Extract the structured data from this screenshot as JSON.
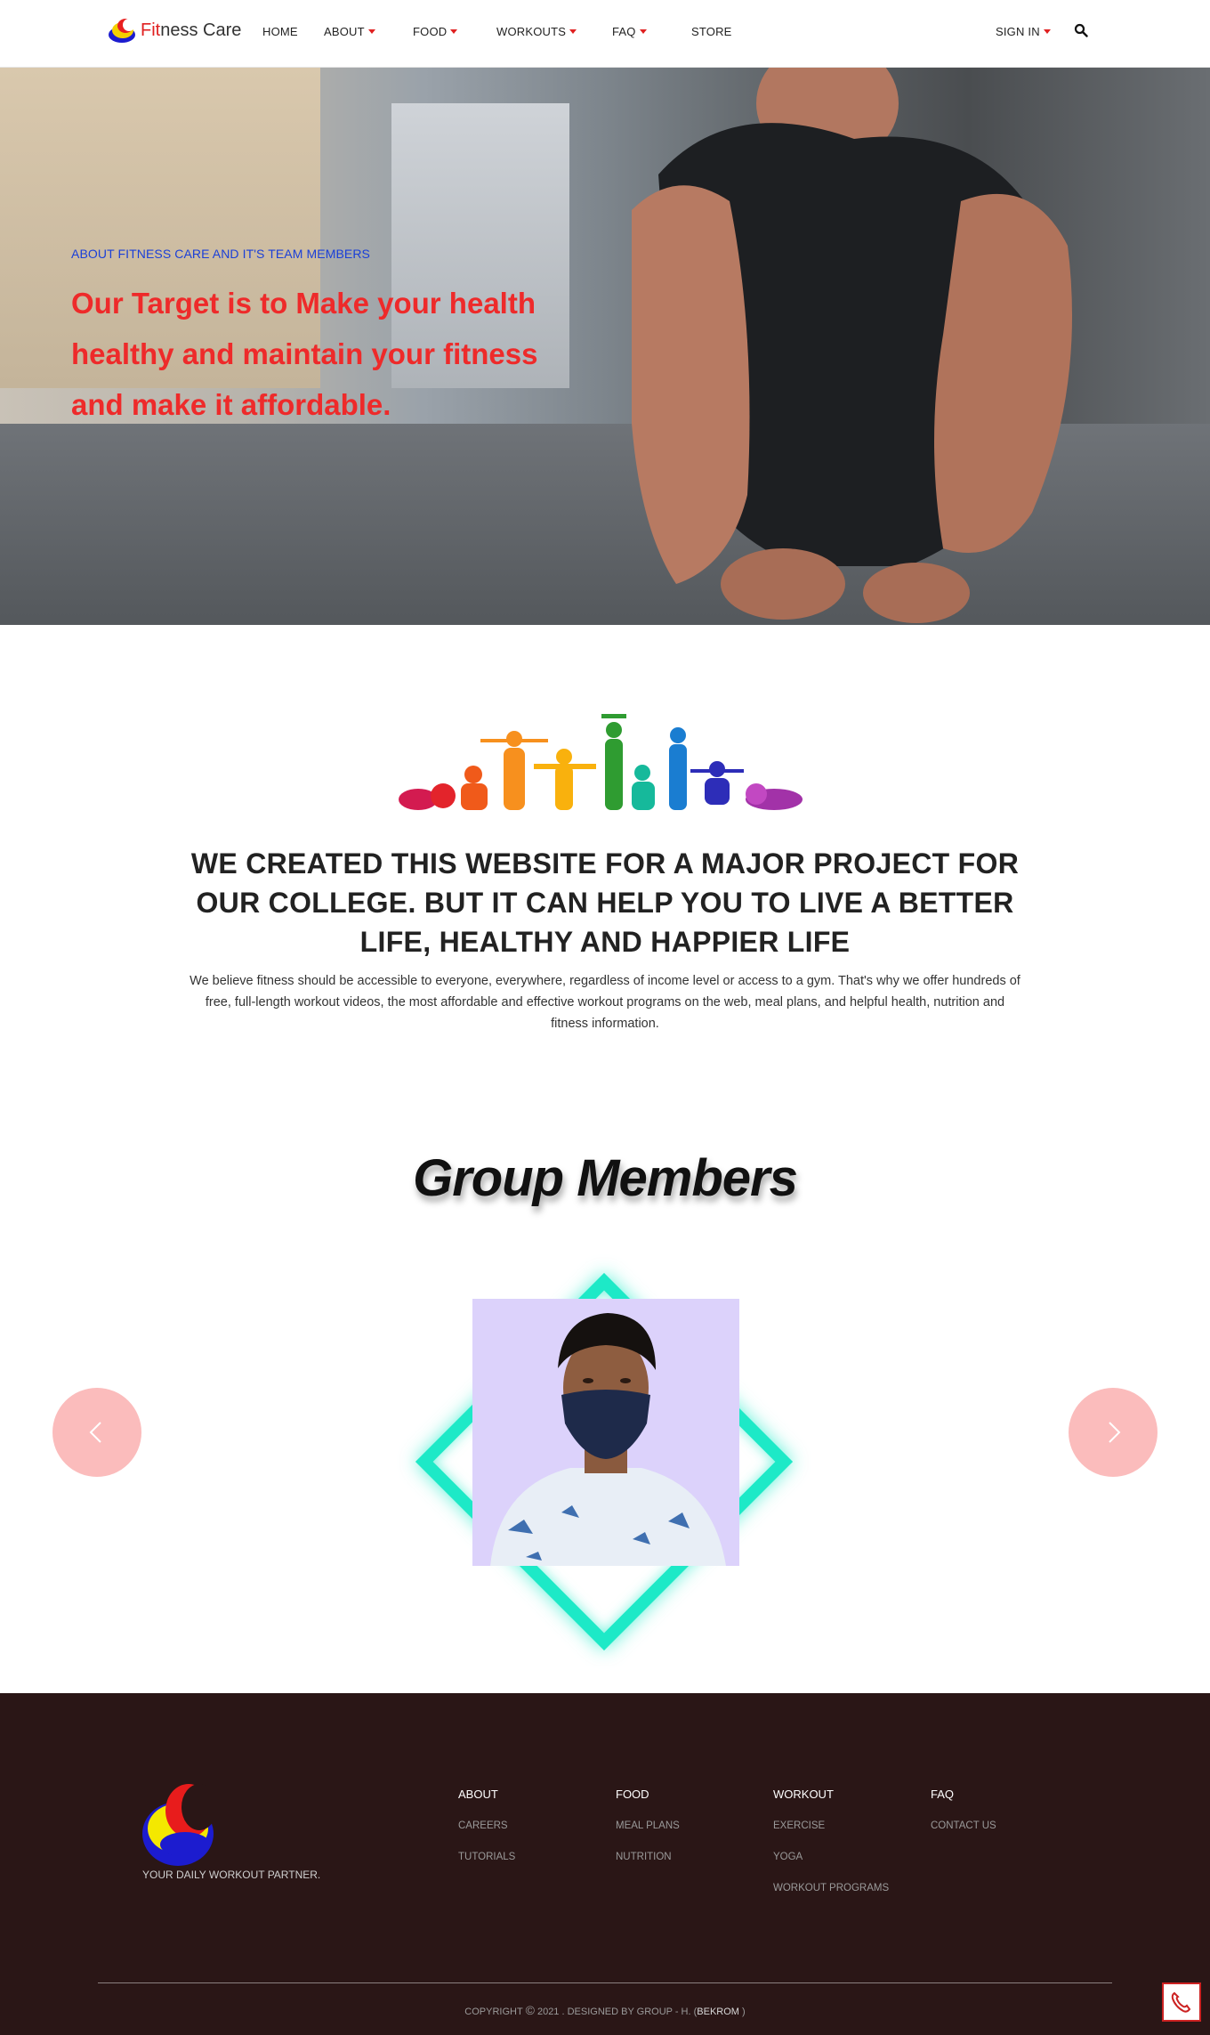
{
  "brand": {
    "name_part1": "Fit",
    "name_part2": "ness Care"
  },
  "nav": {
    "home": "HOME",
    "about": "ABOUT",
    "food": "FOOD",
    "workouts": "WORKOUTS",
    "faq": "FAQ",
    "store": "STORE",
    "sign_in": "SIGN IN"
  },
  "hero": {
    "subtitle": "ABOUT FITNESS CARE AND IT'S TEAM MEMBERS",
    "title": "Our Target is to Make your health healthy and maintain your fitness and make it affordable."
  },
  "about": {
    "headline": "WE CREATED THIS WEBSITE FOR A MAJOR PROJECT FOR OUR COLLEGE. BUT IT CAN HELP YOU TO LIVE A BETTER LIFE, HEALTHY AND HAPPIER LIFE",
    "body": "We believe fitness should be accessible to everyone, everywhere, regardless of income level or access to a gym. That's why we offer hundreds of free, full-length workout videos, the most affordable and effective workout programs on the web, meal plans, and helpful health, nutrition and fitness information."
  },
  "group": {
    "title": "Group Members"
  },
  "footer": {
    "tagline": "YOUR DAILY WORKOUT PARTNER.",
    "columns": [
      {
        "title": "ABOUT",
        "links": [
          "CAREERS",
          "TUTORIALS"
        ]
      },
      {
        "title": "FOOD",
        "links": [
          "MEAL PLANS",
          "NUTRITION"
        ]
      },
      {
        "title": "WORKOUT",
        "links": [
          "EXERCISE",
          "YOGA",
          "WORKOUT PROGRAMS"
        ]
      },
      {
        "title": "FAQ",
        "links": [
          "CONTACT US"
        ]
      }
    ],
    "copyright_prefix": "COPYRIGHT",
    "copyright_symbol": "©",
    "copyright_text": "2021 . DESIGNED BY GROUP - H. (",
    "copyright_name": "BEKROM",
    "copyright_suffix": ")"
  },
  "colors": {
    "accent_red": "#e02020",
    "hero_title": "#ee2a2a",
    "hero_subtitle": "#1a3fd8",
    "diamond": "#1de9c7",
    "carousel_button": "#fbbcbc",
    "footer_bg": "#2a1616"
  },
  "icons": {
    "search": "search-icon",
    "prev": "chevron-left-icon",
    "next": "chevron-right-icon",
    "call": "phone-icon"
  }
}
